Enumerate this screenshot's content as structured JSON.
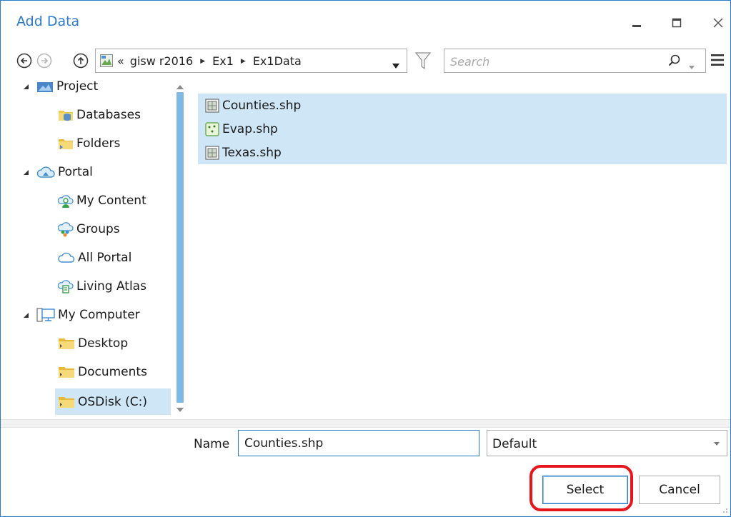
{
  "window": {
    "title": "Add Data"
  },
  "nav": {
    "breadcrumb": [
      "gisw r2016",
      "Ex1",
      "Ex1Data"
    ],
    "overflow": "«",
    "search_placeholder": "Search"
  },
  "tree": {
    "items": [
      {
        "label": "Project",
        "icon": "project-icon",
        "expanded": true,
        "level": 0
      },
      {
        "label": "Databases",
        "icon": "databases-folder-icon",
        "level": 1
      },
      {
        "label": "Folders",
        "icon": "folders-folder-icon",
        "level": 1
      },
      {
        "label": "Portal",
        "icon": "portal-cloud-icon",
        "expanded": true,
        "level": 0
      },
      {
        "label": "My Content",
        "icon": "my-content-icon",
        "level": 1
      },
      {
        "label": "Groups",
        "icon": "groups-icon",
        "level": 1
      },
      {
        "label": "All Portal",
        "icon": "cloud-icon",
        "level": 1
      },
      {
        "label": "Living Atlas",
        "icon": "living-atlas-icon",
        "level": 1
      },
      {
        "label": "My Computer",
        "icon": "computer-icon",
        "expanded": true,
        "level": 0
      },
      {
        "label": "Desktop",
        "icon": "folder-icon",
        "level": 1
      },
      {
        "label": "Documents",
        "icon": "folder-icon",
        "level": 1
      },
      {
        "label": "OSDisk (C:)",
        "icon": "folder-icon",
        "level": 1,
        "selected": true
      }
    ]
  },
  "files": [
    {
      "name": "Counties.shp",
      "icon": "polygon-shapefile-icon"
    },
    {
      "name": "Evap.shp",
      "icon": "point-shapefile-icon"
    },
    {
      "name": "Texas.shp",
      "icon": "polygon-shapefile-icon"
    }
  ],
  "footer": {
    "name_label": "Name",
    "name_value": "Counties.shp",
    "type_value": "Default",
    "select_label": "Select",
    "cancel_label": "Cancel"
  },
  "colors": {
    "accent": "#2b79c9",
    "selection": "#cfe6f7",
    "highlight": "#e8141b"
  }
}
